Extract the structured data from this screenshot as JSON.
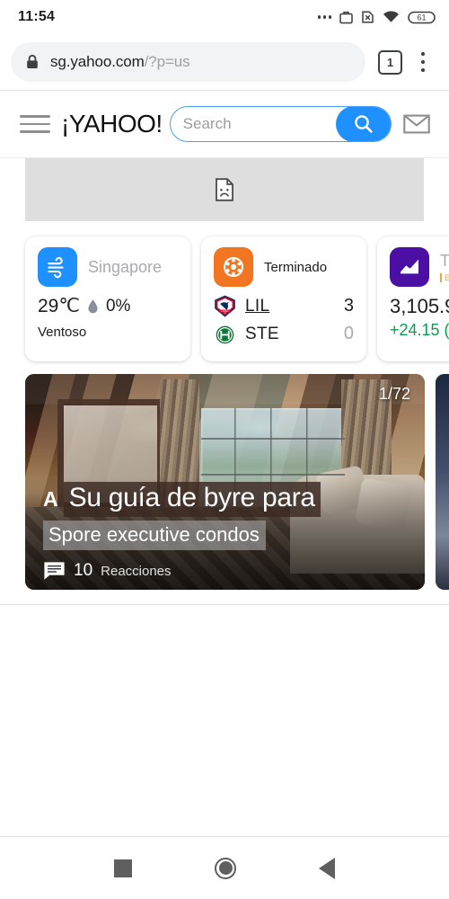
{
  "status_bar": {
    "clock": "11:54",
    "battery_level": "61",
    "icons": [
      "more-dots-icon",
      "work-profile-icon",
      "no-sim-icon",
      "wifi-icon",
      "battery-icon"
    ]
  },
  "browser": {
    "url_host": "sg.yahoo.com",
    "url_path": "/?p=us",
    "tab_count": "1",
    "lock_icon": "lock-icon",
    "menu_icon": "kebab-menu-icon"
  },
  "yahoo_header": {
    "menu_icon": "hamburger-menu-icon",
    "logo": "¡YAHOO!",
    "search_placeholder": "Search",
    "search_value": "",
    "search_icon": "magnifier-icon",
    "mail_icon": "envelope-icon"
  },
  "broken_image": {
    "icon": "broken-image-icon"
  },
  "cards": {
    "weather": {
      "icon": "wind-icon",
      "location": "Singapore",
      "temperature": "29℃",
      "precip_icon": "water-drop-icon",
      "precipitation": "0%",
      "condition": "Ventoso",
      "accent": "#1e90ff"
    },
    "sports": {
      "icon": "soccer-ball-icon",
      "status": "Terminado",
      "accent": "#f27621",
      "teams": [
        {
          "logo": "lille-crest-icon",
          "abbr": "LIL",
          "score": "3",
          "winner": true
        },
        {
          "logo": "saint-etienne-crest-icon",
          "abbr": "STE",
          "score": "0",
          "winner": false
        }
      ]
    },
    "stocks": {
      "icon": "line-chart-icon",
      "name": "Ti",
      "sub": "En",
      "price": "3,105.9",
      "change": "+24.15 (",
      "accent": "#4b0fa3",
      "change_color": "#0c9d4f"
    }
  },
  "article": {
    "pager": "1/72",
    "amp_badge": "A",
    "title": "Su guía de byre para",
    "subtitle": "Spore executive condos",
    "reactions_icon": "comment-icon",
    "reactions_count": "10",
    "reactions_label": "Reacciones"
  },
  "nav_bar": {
    "recents": "recents-square-icon",
    "home": "home-circle-icon",
    "back": "back-triangle-icon"
  }
}
